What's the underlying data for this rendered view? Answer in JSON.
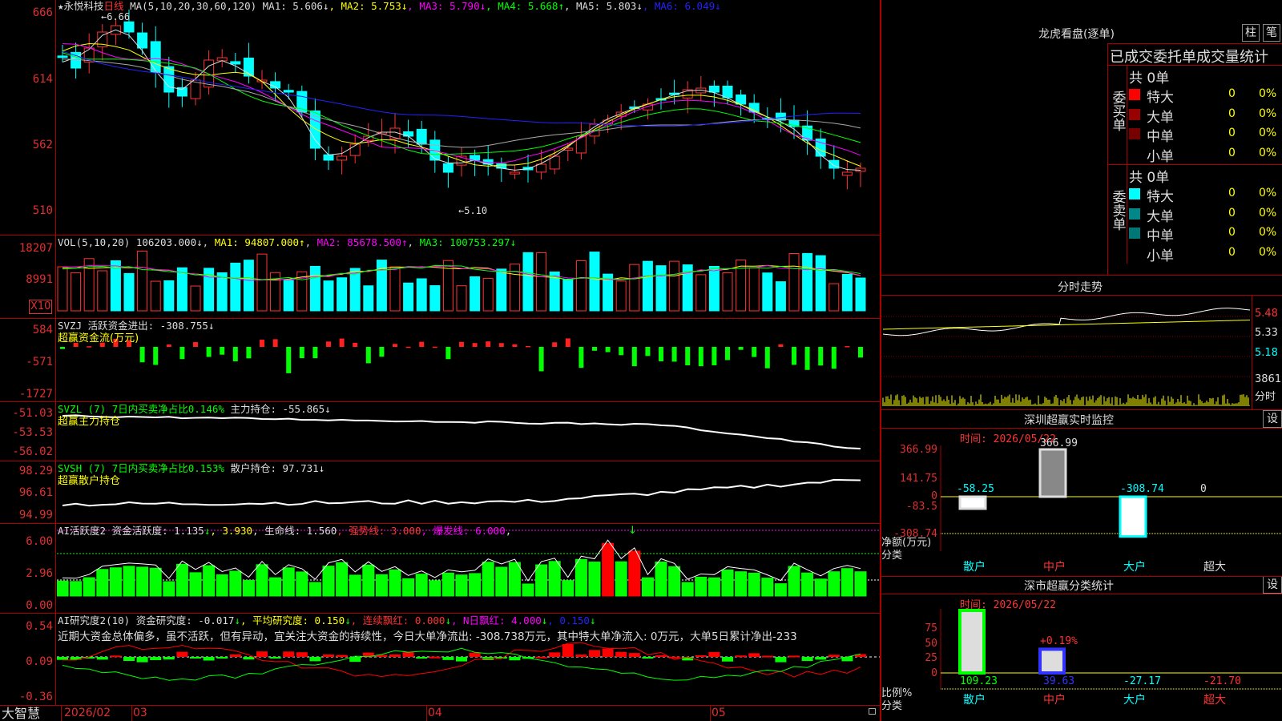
{
  "kline": {
    "name": "★永悦科技",
    "period": "日线",
    "ma_text": "MA(5,10,20,30,60,120)",
    "ma": [
      {
        "label": "MA1: 5.606↓",
        "color": "#ddd"
      },
      {
        "label": "MA2: 5.753↓",
        "color": "#ff0"
      },
      {
        "label": "MA3: 5.790↓",
        "color": "#f0f"
      },
      {
        "label": "MA4: 5.668↑",
        "color": "#0f0"
      },
      {
        "label": "MA5: 5.803↓",
        "color": "#ddd"
      },
      {
        "label": "MA6: 6.049↓",
        "color": "#22f"
      }
    ],
    "y": [
      "666",
      "614",
      "562",
      "510"
    ],
    "hi_label": "6.66",
    "lo_label": "5.10",
    "hi_arrow": "←",
    "lo_arrow": "←"
  },
  "vol": {
    "text": "VOL(5,10,20)",
    "cur": "106203.000↓",
    "ma1": "MA1: 94807.000↑",
    "ma2": "MA2: 85678.500↑",
    "ma3": "MA3: 100753.297↓",
    "y": [
      "18207",
      "8991"
    ],
    "unit": "X10"
  },
  "svzj": {
    "line1": "SVZJ  活跃资金进出: -308.755↓",
    "line2": "超赢资金流(万元)",
    "y": [
      "584",
      "-571",
      "-1727"
    ]
  },
  "svzl": {
    "line1a": "SVZL (7) 7日内买卖净占比0.146%",
    "line1b": " 主力持仓: -55.865↓",
    "line2": "超赢主力持仓",
    "y": [
      "-51.03",
      "-53.53",
      "-56.02"
    ]
  },
  "svsh": {
    "line1a": "SVSH (7) 7日内买卖净占比0.153%",
    "line1b": " 散户持仓: 97.731↓",
    "line2": "超赢散户持仓",
    "y": [
      "98.29",
      "96.61",
      "94.99"
    ]
  },
  "ai1": {
    "t1": "AI活跃度2 资金活跃度: 1.135",
    "t1b": "↓",
    "t2": ", 3.930",
    "t3": ", 生命线: 1.560",
    "t4": ", 强势线: 3.000",
    "t5": ", 爆发线: 6.000",
    "t6": ",",
    "t7": "↓",
    "y": [
      "6.00",
      "2.96",
      "0.00"
    ]
  },
  "ai2": {
    "t1": "AI研究度2(10) 资金研究度: -0.017",
    "t1b": "↓",
    "t2": ", 平均研究度: 0.150",
    "t2b": "↓",
    "t3": ", 连续飘红: 0.000",
    "t3b": "↓",
    "t4": ", N日飘红: 4.000",
    "t4b": "↓",
    "t5": ", 0.150",
    "t5b": "↓",
    "msg": "近期大资金总体偏多，虽不活跃，但有异动，宜关注大资金的持续性，今日大单净流出: -308.738万元，其中特大单净流入: 0万元，大单5日累计净出-233",
    "y": [
      "0.54",
      "0.09",
      "-0.36"
    ]
  },
  "xaxis": {
    "brand": "大智慧",
    "labels": [
      "2026/02",
      "03",
      "04",
      "05"
    ]
  },
  "longhu": {
    "title": "龙虎看盘(逐单)",
    "btn_bar": "柱",
    "btn_pen": "笔",
    "subtitle": "已成交委托单成交量统计",
    "buy": {
      "side": "委买单",
      "total": "共 0单",
      "rows": [
        {
          "label": "特大",
          "v": "0",
          "p": "0%",
          "c": "#f00"
        },
        {
          "label": "大单",
          "v": "0",
          "p": "0%",
          "c": "#900"
        },
        {
          "label": "中单",
          "v": "0",
          "p": "0%",
          "c": "#700"
        },
        {
          "label": "小单",
          "v": "0",
          "p": "0%",
          "c": "#000"
        }
      ]
    },
    "sell": {
      "side": "委卖单",
      "total": "共 0单",
      "rows": [
        {
          "label": "特大",
          "v": "0",
          "p": "0%",
          "c": "#0ff"
        },
        {
          "label": "大单",
          "v": "0",
          "p": "0%",
          "c": "#088"
        },
        {
          "label": "中单",
          "v": "0",
          "p": "0%",
          "c": "#077"
        },
        {
          "label": "小单",
          "v": "0",
          "p": "0%",
          "c": "#000"
        }
      ]
    }
  },
  "fenshi": {
    "title": "分时走势",
    "y": [
      "5.48",
      "5.33",
      "5.18"
    ],
    "vol": "3861",
    "vol_unit": "分时"
  },
  "sz": {
    "title": "深圳超赢实时监控",
    "btn": "设",
    "date": "时间: 2026/05/22",
    "y": [
      "366.99",
      "141.75",
      "0",
      "-83.5",
      "-308.74"
    ],
    "unit": "净额(万元)",
    "cat_label": "分类",
    "cats": [
      "散户",
      "中户",
      "大户",
      "超大"
    ],
    "values": [
      "-58.25",
      "366.99",
      "-308.74",
      "0"
    ],
    "top_value": "366.99"
  },
  "sc": {
    "title": "深市超赢分类统计",
    "btn": "设",
    "date": "时间: 2026/05/22",
    "y": [
      "75",
      "50",
      "25",
      "0"
    ],
    "unit": "比例%",
    "cat_label": "分类",
    "cats": [
      "散户",
      "中户",
      "大户",
      "超大"
    ],
    "values": [
      "109.23",
      "39.63",
      "-27.17",
      "-21.70"
    ],
    "annot": "+0.19%"
  }
}
